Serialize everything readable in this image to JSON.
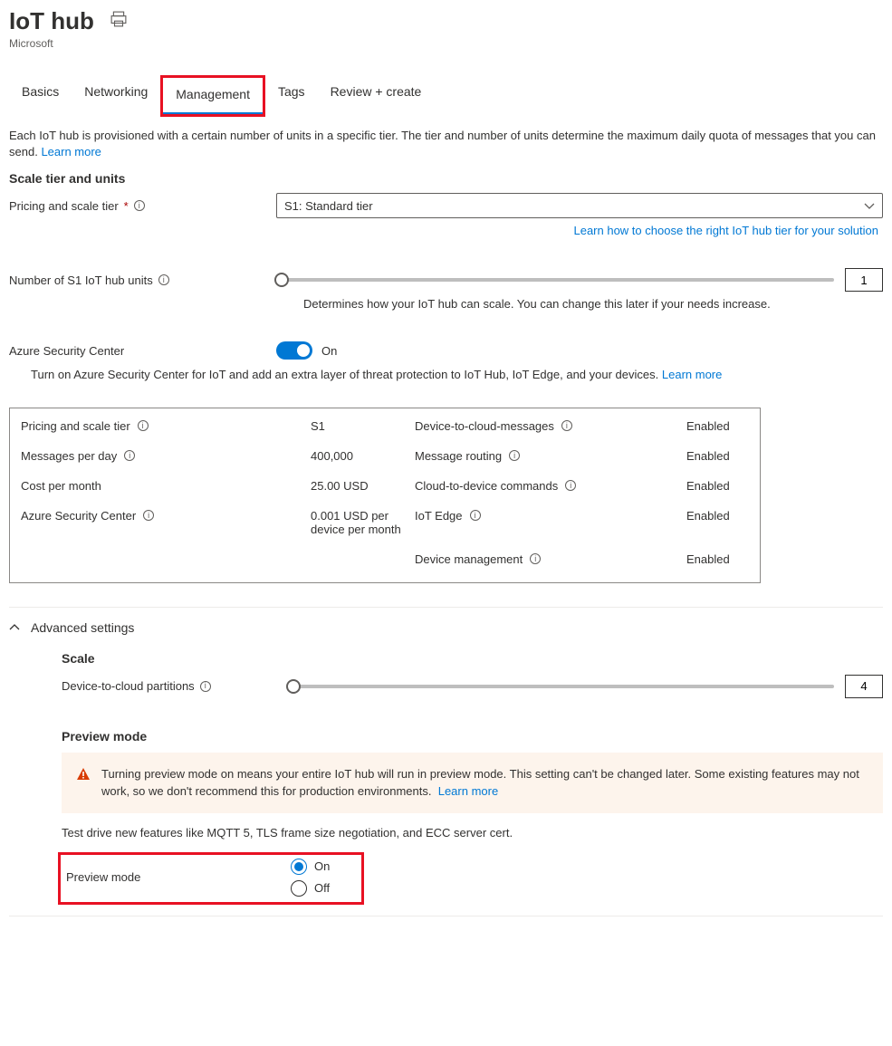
{
  "header": {
    "title": "IoT hub",
    "provider": "Microsoft"
  },
  "tabs": {
    "items": [
      {
        "label": "Basics"
      },
      {
        "label": "Networking"
      },
      {
        "label": "Management",
        "active": true,
        "highlighted": true
      },
      {
        "label": "Tags"
      },
      {
        "label": "Review + create"
      }
    ]
  },
  "intro": {
    "text": "Each IoT hub is provisioned with a certain number of units in a specific tier. The tier and number of units determine the maximum daily quota of messages that you can send.",
    "learn_more": "Learn more"
  },
  "scale": {
    "heading": "Scale tier and units",
    "pricing_label": "Pricing and scale tier",
    "pricing_value": "S1: Standard tier",
    "tier_helper_link": "Learn how to choose the right IoT hub tier for your solution",
    "units_label": "Number of S1 IoT hub units",
    "units_value": "1",
    "units_helper": "Determines how your IoT hub can scale. You can change this later if your needs increase."
  },
  "asc": {
    "label": "Azure Security Center",
    "state": "On",
    "description": "Turn on Azure Security Center for IoT and add an extra layer of threat protection to IoT Hub, IoT Edge, and your devices.",
    "learn_more": "Learn more"
  },
  "summary": {
    "left": [
      {
        "label": "Pricing and scale tier",
        "value": "S1",
        "info": true
      },
      {
        "label": "Messages per day",
        "value": "400,000",
        "info": true
      },
      {
        "label": "Cost per month",
        "value": "25.00 USD",
        "info": false
      },
      {
        "label": "Azure Security Center",
        "value": "0.001 USD per device per month",
        "info": true
      }
    ],
    "right": [
      {
        "label": "Device-to-cloud-messages",
        "value": "Enabled",
        "info": true
      },
      {
        "label": "Message routing",
        "value": "Enabled",
        "info": true
      },
      {
        "label": "Cloud-to-device commands",
        "value": "Enabled",
        "info": true
      },
      {
        "label": "IoT Edge",
        "value": "Enabled",
        "info": true
      },
      {
        "label": "Device management",
        "value": "Enabled",
        "info": true
      }
    ]
  },
  "advanced": {
    "heading": "Advanced settings",
    "scale_h": "Scale",
    "partitions_label": "Device-to-cloud partitions",
    "partitions_value": "4",
    "preview_h": "Preview mode",
    "warning_text": "Turning preview mode on means your entire IoT hub will run in preview mode. This setting can't be changed later. Some existing features may not work, so we don't recommend this for production environments.",
    "warning_learn_more": "Learn more",
    "preview_desc": "Test drive new features like MQTT 5, TLS frame size negotiation, and ECC server cert.",
    "preview_label": "Preview mode",
    "preview_on": "On",
    "preview_off": "Off",
    "preview_selected": "on"
  }
}
